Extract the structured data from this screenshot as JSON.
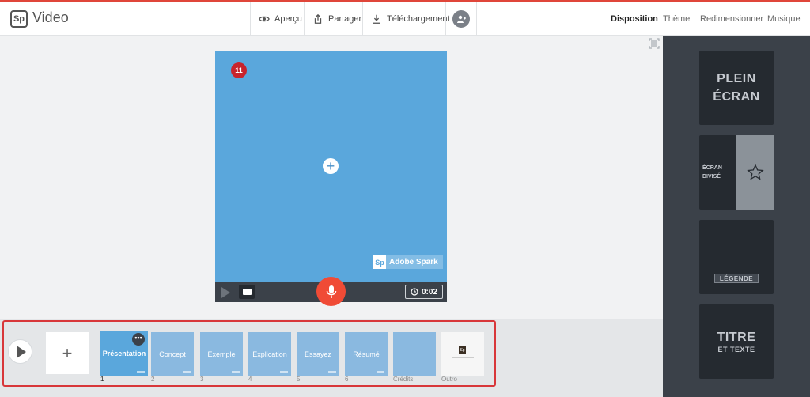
{
  "app": {
    "logo": "Sp",
    "title": "Video"
  },
  "header": {
    "preview": {
      "label": "Aperçu",
      "icon": "eye-icon"
    },
    "share": {
      "label": "Partager",
      "icon": "share-icon"
    },
    "download": {
      "label": "Téléchargement",
      "icon": "download-icon"
    },
    "collaborate": {
      "icon": "add-user-icon"
    }
  },
  "tabs": [
    {
      "label": "Disposition",
      "active": true
    },
    {
      "label": "Thème",
      "active": false
    },
    {
      "label": "Redimensionner",
      "active": false
    },
    {
      "label": "Musique",
      "active": false
    }
  ],
  "canvas": {
    "badge": "11",
    "background_color": "#5aa7dc",
    "watermark_logo": "Sp",
    "watermark_text": "Adobe Spark"
  },
  "controls": {
    "duration": "0:02"
  },
  "timeline": {
    "slides": [
      {
        "label": "Présentation",
        "number": "1",
        "active": true
      },
      {
        "label": "Concept",
        "number": "2"
      },
      {
        "label": "Exemple",
        "number": "3"
      },
      {
        "label": "Explication",
        "number": "4"
      },
      {
        "label": "Essayez",
        "number": "5"
      },
      {
        "label": "Résumé",
        "number": "6"
      },
      {
        "label": "",
        "number": "Crédits"
      },
      {
        "label": "",
        "number": "Outro"
      }
    ],
    "more_glyph": "•••",
    "add_glyph": "+"
  },
  "layouts": {
    "plein_ecran": {
      "line1": "PLEIN",
      "line2": "ÉCRAN"
    },
    "ecran_divise": {
      "line1": "ÉCRAN",
      "line2": "DIVISÉ",
      "icon": "star-icon"
    },
    "legende": {
      "label": "LÉGENDE"
    },
    "titre": {
      "main": "TITRE",
      "sub": "ET TEXTE"
    }
  },
  "colors": {
    "accent_red": "#f04b36",
    "badge_red": "#c8232c",
    "panel_dark": "#3b4149",
    "tile_dark": "#252a30"
  }
}
